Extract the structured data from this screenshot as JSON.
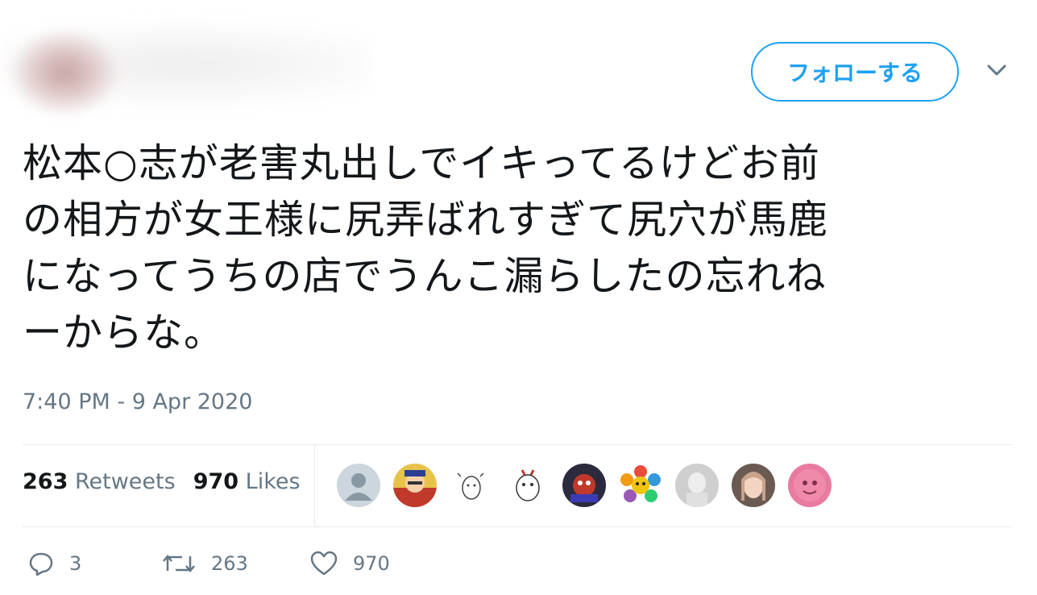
{
  "header": {
    "follow_label": "フォローする",
    "caret_icon": "chevron-down-icon"
  },
  "tweet": {
    "lines": [
      "松本○志が老害丸出しでイキってるけどお前",
      "の相方が女王様に尻弄ばれすぎて尻穴が馬鹿",
      "になってうちの店でうんこ漏らしたの忘れね",
      "ーからな。"
    ],
    "timestamp": "7:40 PM - 9 Apr 2020"
  },
  "stats": {
    "retweets_count": "263",
    "retweets_label": "Retweets",
    "likes_count": "970",
    "likes_label": "Likes"
  },
  "actions": {
    "reply_count": "3",
    "retweet_count": "263",
    "like_count": "970"
  },
  "colors": {
    "accent": "#1da1f2",
    "text": "#14171a",
    "muted": "#657786",
    "divider": "#e6ecf0"
  }
}
